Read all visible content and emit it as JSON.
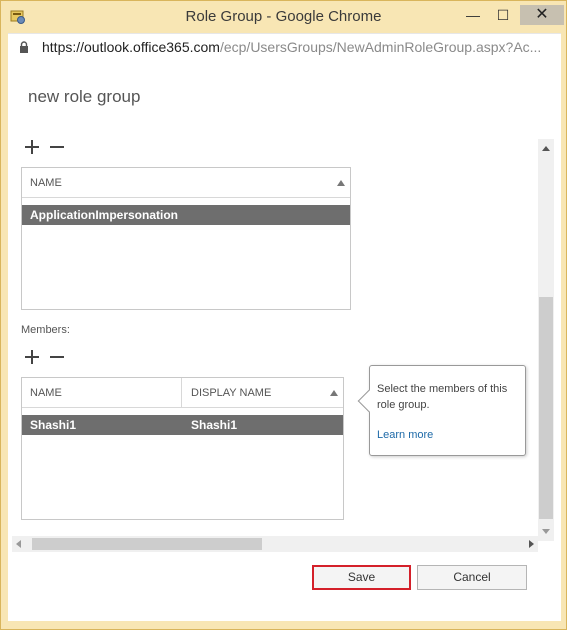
{
  "window": {
    "title": "Role Group - Google Chrome",
    "minimize": "—",
    "maximize": "☐",
    "close": "✕"
  },
  "address": {
    "host": "https://outlook.office365.com",
    "path": "/ecp/UsersGroups/NewAdminRoleGroup.aspx?Ac..."
  },
  "page": {
    "title": "new role group"
  },
  "roles": {
    "columns": [
      "NAME"
    ],
    "rows": [
      [
        "ApplicationImpersonation"
      ]
    ]
  },
  "members": {
    "label": "Members:",
    "columns": [
      "NAME",
      "DISPLAY NAME"
    ],
    "rows": [
      [
        "Shashi1",
        "Shashi1"
      ]
    ]
  },
  "callout": {
    "text": "Select the members of this role group.",
    "link": "Learn more"
  },
  "buttons": {
    "save": "Save",
    "cancel": "Cancel"
  },
  "colors": {
    "highlight_border": "#d4202a",
    "selected_row": "#6e6e6e",
    "link": "#1e6aa8"
  }
}
